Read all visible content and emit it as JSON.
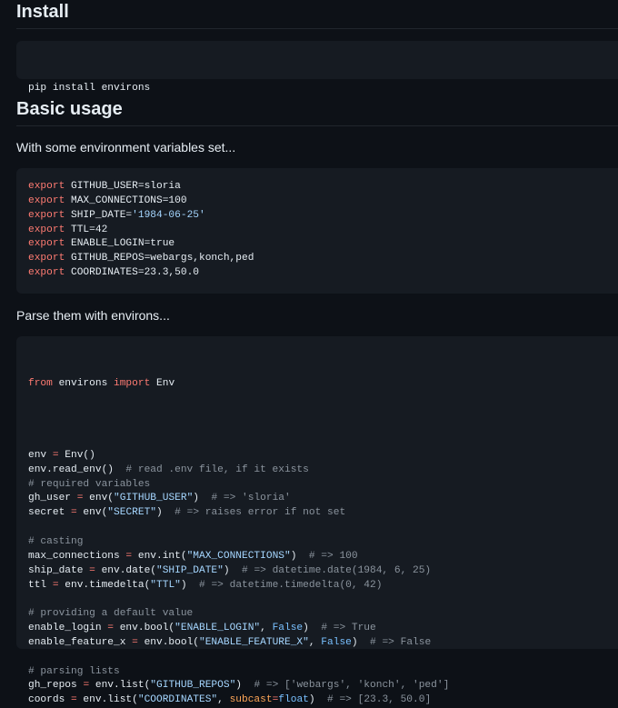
{
  "install": {
    "heading": "Install",
    "command": "pip install environs"
  },
  "basic_usage": {
    "heading": "Basic usage",
    "intro": "With some environment variables set...",
    "exports": [
      {
        "kw": "export",
        "name": "GITHUB_USER=",
        "value": "sloria",
        "value_is_string": false
      },
      {
        "kw": "export",
        "name": "MAX_CONNECTIONS=",
        "value": "100",
        "value_is_string": false
      },
      {
        "kw": "export",
        "name": "SHIP_DATE=",
        "value": "'1984-06-25'",
        "value_is_string": true
      },
      {
        "kw": "export",
        "name": "TTL=",
        "value": "42",
        "value_is_string": false
      },
      {
        "kw": "export",
        "name": "ENABLE_LOGIN=",
        "value": "true",
        "value_is_string": false
      },
      {
        "kw": "export",
        "name": "GITHUB_REPOS=",
        "value": "webargs,konch,ped",
        "value_is_string": false
      },
      {
        "kw": "export",
        "name": "COORDINATES=",
        "value": "23.3,50.0",
        "value_is_string": false
      }
    ],
    "parse_intro": "Parse them with environs..."
  },
  "python_code": {
    "import_from": "from",
    "import_module": " environs ",
    "import_kw": "import",
    "import_name": " Env",
    "lines": [
      {
        "t": [
          [
            "",
            "env "
          ],
          [
            "op",
            "="
          ],
          [
            "",
            " Env()"
          ]
        ]
      },
      {
        "t": [
          [
            "",
            "env.read_env()  "
          ],
          [
            "cm",
            "# read .env file, if it exists"
          ]
        ]
      },
      {
        "t": [
          [
            "cm",
            "# required variables"
          ]
        ]
      },
      {
        "t": [
          [
            "",
            "gh_user "
          ],
          [
            "op",
            "="
          ],
          [
            "",
            " env("
          ],
          [
            "str",
            "\"GITHUB_USER\""
          ],
          [
            "",
            ")  "
          ],
          [
            "cm",
            "# => 'sloria'"
          ]
        ]
      },
      {
        "t": [
          [
            "",
            "secret "
          ],
          [
            "op",
            "="
          ],
          [
            "",
            " env("
          ],
          [
            "str",
            "\"SECRET\""
          ],
          [
            "",
            ")  "
          ],
          [
            "cm",
            "# => raises error if not set"
          ]
        ]
      },
      {
        "t": []
      },
      {
        "t": [
          [
            "cm",
            "# casting"
          ]
        ]
      },
      {
        "t": [
          [
            "",
            "max_connections "
          ],
          [
            "op",
            "="
          ],
          [
            "",
            " env.int("
          ],
          [
            "str",
            "\"MAX_CONNECTIONS\""
          ],
          [
            "",
            ")  "
          ],
          [
            "cm",
            "# => 100"
          ]
        ]
      },
      {
        "t": [
          [
            "",
            "ship_date "
          ],
          [
            "op",
            "="
          ],
          [
            "",
            " env.date("
          ],
          [
            "str",
            "\"SHIP_DATE\""
          ],
          [
            "",
            ")  "
          ],
          [
            "cm",
            "# => datetime.date(1984, 6, 25)"
          ]
        ]
      },
      {
        "t": [
          [
            "",
            "ttl "
          ],
          [
            "op",
            "="
          ],
          [
            "",
            " env.timedelta("
          ],
          [
            "str",
            "\"TTL\""
          ],
          [
            "",
            ")  "
          ],
          [
            "cm",
            "# => datetime.timedelta(0, 42)"
          ]
        ]
      },
      {
        "t": []
      },
      {
        "t": [
          [
            "cm",
            "# providing a default value"
          ]
        ]
      },
      {
        "t": [
          [
            "",
            "enable_login "
          ],
          [
            "op",
            "="
          ],
          [
            "",
            " env.bool("
          ],
          [
            "str",
            "\"ENABLE_LOGIN\""
          ],
          [
            "",
            ", "
          ],
          [
            "cst",
            "False"
          ],
          [
            "",
            ")  "
          ],
          [
            "cm",
            "# => True"
          ]
        ]
      },
      {
        "t": [
          [
            "",
            "enable_feature_x "
          ],
          [
            "op",
            "="
          ],
          [
            "",
            " env.bool("
          ],
          [
            "str",
            "\"ENABLE_FEATURE_X\""
          ],
          [
            "",
            ", "
          ],
          [
            "cst",
            "False"
          ],
          [
            "",
            ")  "
          ],
          [
            "cm",
            "# => False"
          ]
        ]
      },
      {
        "t": []
      },
      {
        "t": [
          [
            "cm",
            "# parsing lists"
          ]
        ]
      },
      {
        "t": [
          [
            "",
            "gh_repos "
          ],
          [
            "op",
            "="
          ],
          [
            "",
            " env.list("
          ],
          [
            "str",
            "\"GITHUB_REPOS\""
          ],
          [
            "",
            ")  "
          ],
          [
            "cm",
            "# => ['webargs', 'konch', 'ped']"
          ]
        ]
      },
      {
        "t": [
          [
            "",
            "coords "
          ],
          [
            "op",
            "="
          ],
          [
            "",
            " env.list("
          ],
          [
            "str",
            "\"COORDINATES\""
          ],
          [
            "",
            ", "
          ],
          [
            "prm",
            "subcast"
          ],
          [
            "op",
            "="
          ],
          [
            "cst",
            "float"
          ],
          [
            "",
            ")  "
          ],
          [
            "cm",
            "# => [23.3, 50.0]"
          ]
        ]
      }
    ]
  }
}
